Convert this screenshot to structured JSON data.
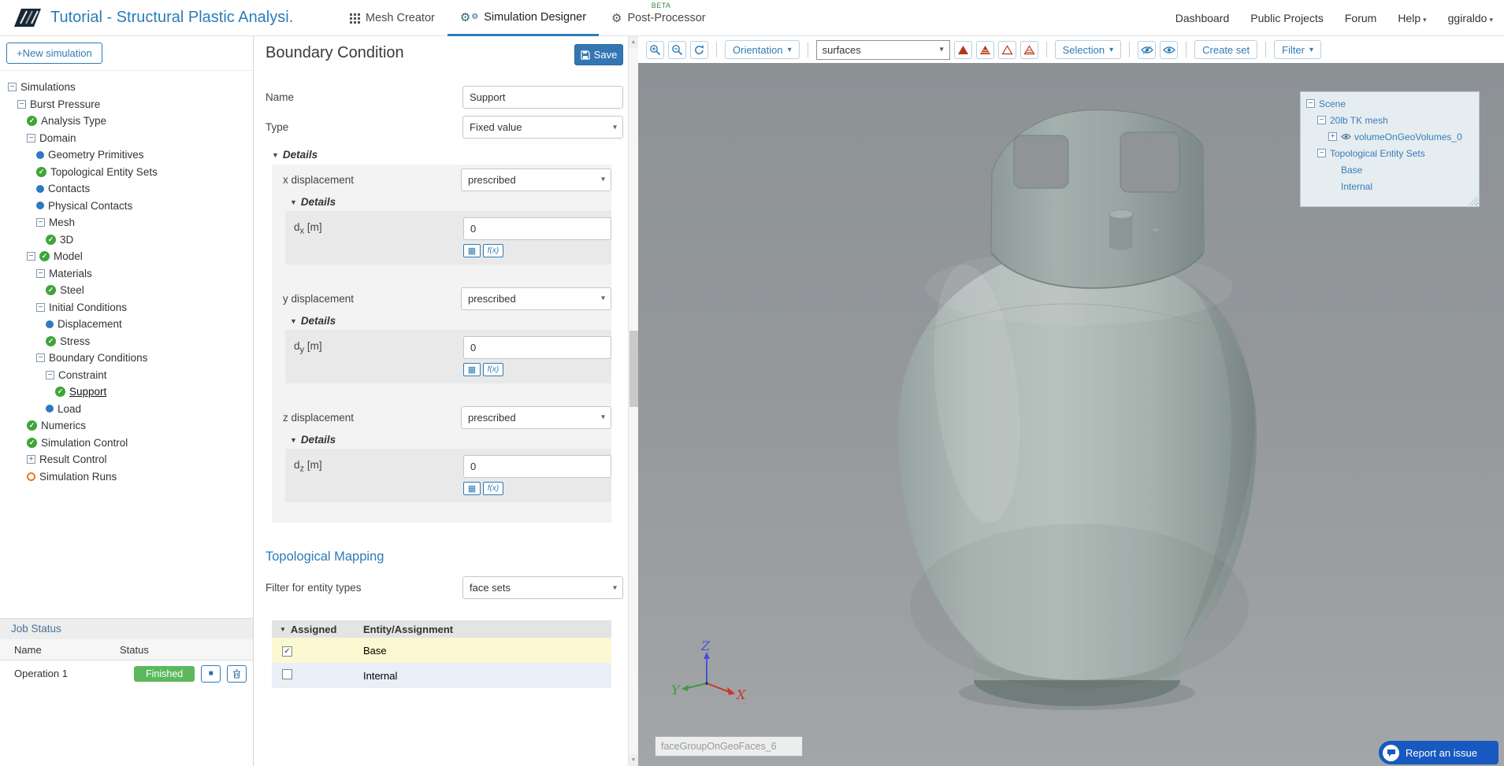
{
  "icons": {
    "caret": "▾",
    "tri_down": "▼",
    "up": "▲",
    "down": "▼",
    "plus": "+",
    "minus": "−",
    "check": "✓",
    "stop": "■",
    "table_grid": "▦",
    "gear": "⚙"
  },
  "colors": {
    "accent_blue": "#2f7cb5",
    "green_check": "#3fa43a",
    "badge_green": "#5cb85c",
    "tree_dot_blue": "#2f79c2",
    "runs_orange": "#e87b1e",
    "report_blue": "#1759c0"
  },
  "navbar": {
    "title": "Tutorial - Structural Plastic Analysi...",
    "tabs": [
      {
        "label": "Mesh Creator",
        "active": false
      },
      {
        "label": "Simulation Designer",
        "active": true
      },
      {
        "label": "Post-Processor",
        "active": false,
        "badge": "BETA"
      }
    ],
    "links": [
      "Dashboard",
      "Public Projects",
      "Forum"
    ],
    "help_label": "Help",
    "username": "ggiraldo"
  },
  "sidebar": {
    "new_simulation_label": "+New simulation",
    "tree": [
      {
        "level": 0,
        "icon": "minus",
        "label": "Simulations"
      },
      {
        "level": 1,
        "icon": "minus",
        "label": "Burst Pressure"
      },
      {
        "level": 2,
        "icon": "check",
        "label": "Analysis Type"
      },
      {
        "level": 2,
        "icon": "minus",
        "label": "Domain"
      },
      {
        "level": 3,
        "icon": "dot",
        "label": "Geometry Primitives"
      },
      {
        "level": 3,
        "icon": "check",
        "label": "Topological Entity Sets"
      },
      {
        "level": 3,
        "icon": "dot",
        "label": "Contacts"
      },
      {
        "level": 3,
        "icon": "dot",
        "label": "Physical Contacts"
      },
      {
        "level": 3,
        "icon": "minus",
        "label": "Mesh"
      },
      {
        "level": 4,
        "icon": "check",
        "label": "3D"
      },
      {
        "level": 2,
        "icon": "minus-check",
        "label": "Model"
      },
      {
        "level": 3,
        "icon": "minus",
        "label": "Materials"
      },
      {
        "level": 4,
        "icon": "check",
        "label": "Steel"
      },
      {
        "level": 3,
        "icon": "minus",
        "label": "Initial Conditions"
      },
      {
        "level": 4,
        "icon": "dot",
        "label": "Displacement"
      },
      {
        "level": 4,
        "icon": "check",
        "label": "Stress"
      },
      {
        "level": 3,
        "icon": "minus",
        "label": "Boundary Conditions"
      },
      {
        "level": 4,
        "icon": "minus",
        "label": "Constraint"
      },
      {
        "level": 5,
        "icon": "check",
        "label": "Support",
        "selected": true
      },
      {
        "level": 4,
        "icon": "dot",
        "label": "Load"
      },
      {
        "level": 2,
        "icon": "check",
        "label": "Numerics"
      },
      {
        "level": 2,
        "icon": "check",
        "label": "Simulation Control"
      },
      {
        "level": 2,
        "icon": "plus",
        "label": "Result Control"
      },
      {
        "level": 2,
        "icon": "circle",
        "label": "Simulation Runs"
      }
    ],
    "job_status": {
      "title": "Job Status",
      "columns": [
        "Name",
        "Status"
      ],
      "rows": [
        {
          "name": "Operation 1",
          "status": "Finished"
        }
      ]
    }
  },
  "panel": {
    "title": "Boundary Condition",
    "save_label": "Save",
    "name_label": "Name",
    "name_value": "Support",
    "type_label": "Type",
    "type_value": "Fixed value",
    "details_label": "Details",
    "fx_label": "f(x)",
    "displacements": [
      {
        "label": "x displacement",
        "mode": "prescribed",
        "sym": "d",
        "sub": "x",
        "unit": "[m]",
        "value": "0"
      },
      {
        "label": "y displacement",
        "mode": "prescribed",
        "sym": "d",
        "sub": "y",
        "unit": "[m]",
        "value": "0"
      },
      {
        "label": "z displacement",
        "mode": "prescribed",
        "sym": "d",
        "sub": "z",
        "unit": "[m]",
        "value": "0"
      }
    ],
    "mapping": {
      "title": "Topological Mapping",
      "filter_label": "Filter for entity types",
      "filter_value": "face sets",
      "columns": [
        "Assigned",
        "Entity/Assignment"
      ],
      "rows": [
        {
          "name": "Base",
          "checked": true
        },
        {
          "name": "Internal",
          "checked": false
        }
      ]
    }
  },
  "viewport": {
    "toolbar": {
      "orientation_label": "Orientation",
      "display_mode": "surfaces",
      "selection_label": "Selection",
      "create_set_label": "Create set",
      "filter_label": "Filter"
    },
    "scene_tree": [
      {
        "label": "Scene",
        "level": 0,
        "icon": "minus"
      },
      {
        "label": "20lb TK mesh",
        "level": 1,
        "icon": "minus"
      },
      {
        "label": "volumeOnGeoVolumes_0",
        "level": 2,
        "icon": "plus-eye"
      },
      {
        "label": "Topological Entity Sets",
        "level": 1,
        "icon": "minus"
      },
      {
        "label": "Base",
        "level": 2,
        "icon": "none"
      },
      {
        "label": "Internal",
        "level": 2,
        "icon": "none"
      }
    ],
    "face_group_label": "faceGroupOnGeoFaces_6",
    "axes": {
      "x": "X",
      "y": "Y",
      "z": "Z"
    },
    "report_issue_label": "Report an issue"
  }
}
